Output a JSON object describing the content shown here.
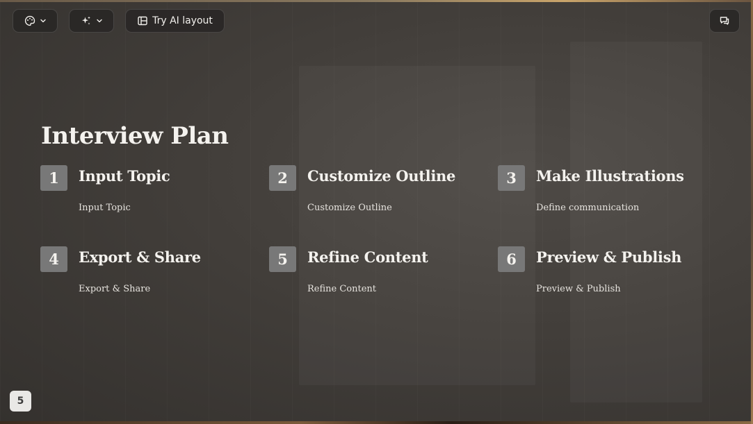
{
  "toolbar": {
    "theme_icon": "palette-icon",
    "ai_icon": "sparkles-icon",
    "layout_icon": "layout-icon",
    "layout_label": "Try AI layout",
    "comments_icon": "comment-icon"
  },
  "slide": {
    "title": "Interview Plan",
    "items": [
      {
        "number": "1",
        "title": "Input Topic",
        "description": "Input Topic"
      },
      {
        "number": "2",
        "title": "Customize Outline",
        "description": "Customize Outline"
      },
      {
        "number": "3",
        "title": "Make Illustrations",
        "description": "Define communication"
      },
      {
        "number": "4",
        "title": "Export & Share",
        "description": "Export & Share"
      },
      {
        "number": "5",
        "title": "Refine Content",
        "description": "Refine Content"
      },
      {
        "number": "6",
        "title": "Preview & Publish",
        "description": "Preview & Publish"
      }
    ]
  },
  "footer": {
    "page_number": "5"
  },
  "colors": {
    "background": "#423e3a",
    "number_box": "#787878",
    "text": "#f4f2ee"
  }
}
